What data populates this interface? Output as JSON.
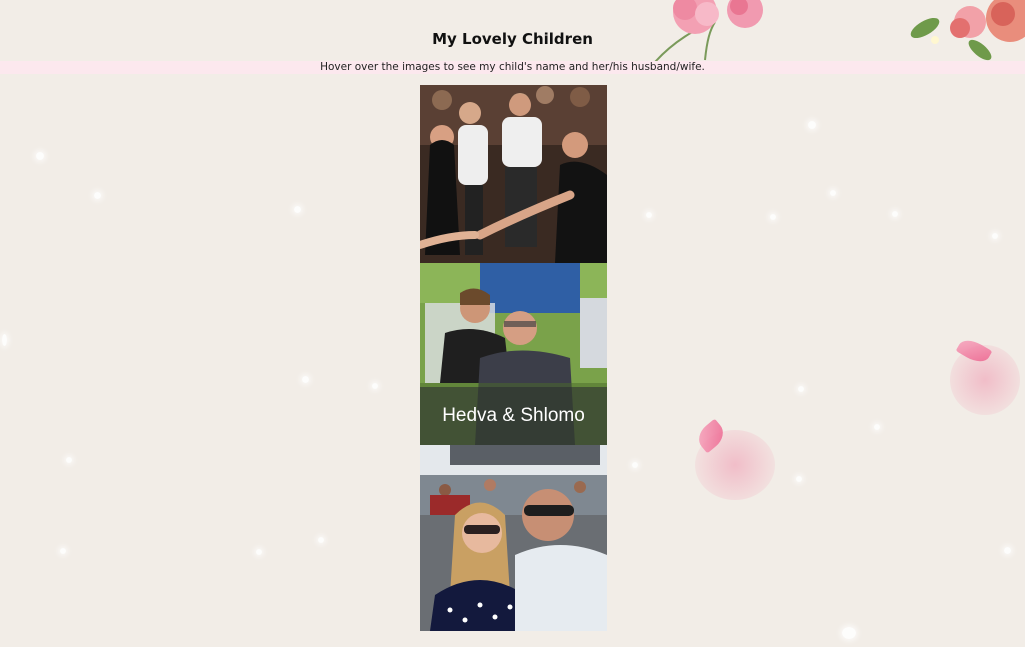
{
  "page": {
    "title": "My Lovely Children",
    "subtitle": "Hover over the images to see my child's name and her/his husband/wife."
  },
  "gallery": {
    "photos": [
      {
        "caption": "",
        "icon": "dancing-party-photo"
      },
      {
        "caption": "Hedva & Shlomo",
        "icon": "couple-garden-photo"
      },
      {
        "caption": "",
        "icon": "couple-selfie-photo"
      }
    ]
  },
  "colors": {
    "background": "#f2ede7",
    "subtitle_band": "#fce8ee",
    "petal": "#ec5d8a"
  }
}
